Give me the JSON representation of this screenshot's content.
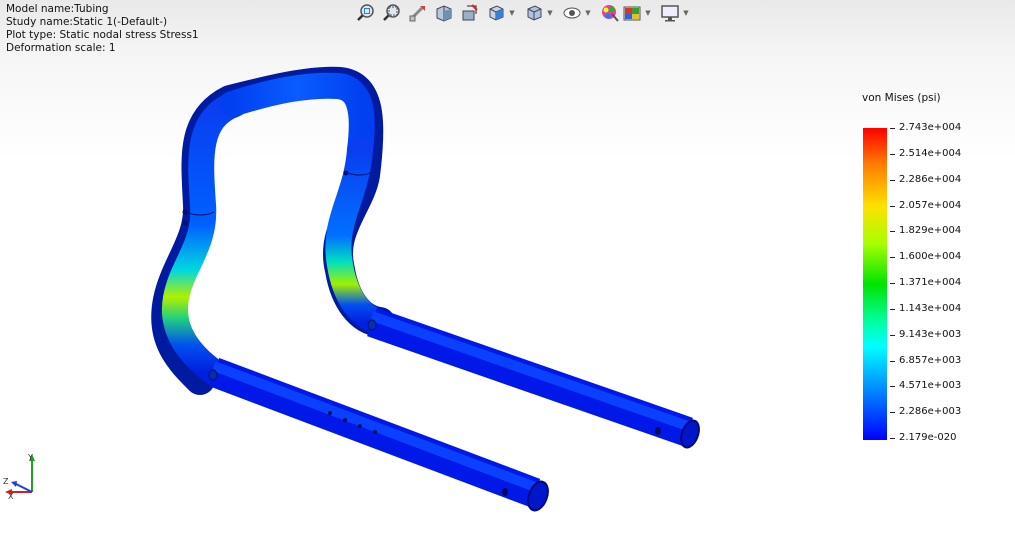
{
  "info": {
    "model_name": "Model name:Tubing",
    "study_name": "Study name:Static 1(-Default-)",
    "plot_type": "Plot type: Static nodal stress Stress1",
    "deformation_scale": "Deformation scale: 1"
  },
  "toolbar": {
    "icons": [
      "zoom-to-fit-icon",
      "zoom-to-area-icon",
      "previous-view-icon",
      "section-view-icon",
      "dynamic-annotation-icon",
      "view-orientation-icon",
      "display-style-icon",
      "hide-show-items-icon",
      "edit-appearance-icon",
      "apply-scene-icon",
      "view-settings-icon"
    ]
  },
  "legend": {
    "title": "von Mises (psi)",
    "ticks": [
      "2.743e+004",
      "2.514e+004",
      "2.286e+004",
      "2.057e+004",
      "1.829e+004",
      "1.600e+004",
      "1.371e+004",
      "1.143e+004",
      "9.143e+003",
      "6.857e+003",
      "4.571e+003",
      "2.286e+003",
      "2.179e-020"
    ],
    "colors": {
      "max": "#ff0000",
      "mid": "#00e400",
      "min": "#0000ff"
    }
  },
  "triad": {
    "x": "X",
    "y": "Y",
    "z": "Z"
  }
}
